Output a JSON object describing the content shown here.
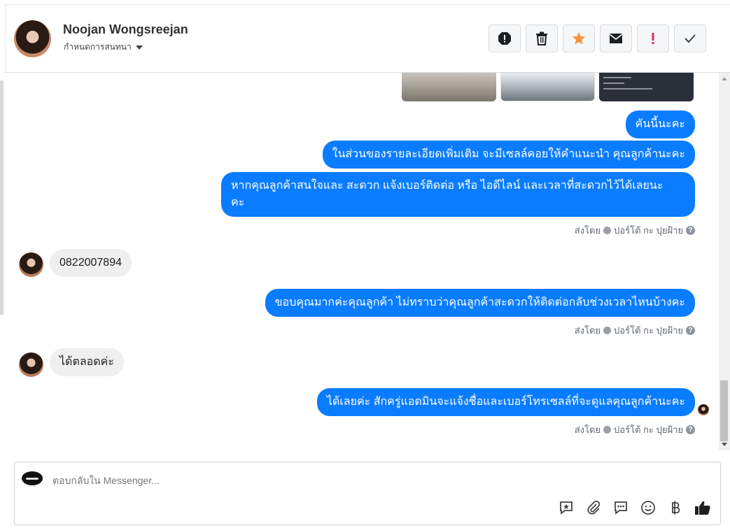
{
  "header": {
    "name": "Noojan Wongsreejan",
    "subtitle": "กำหนดการสนทนา"
  },
  "actions": [
    {
      "name": "spam-button",
      "icon": "stop-icon"
    },
    {
      "name": "delete-button",
      "icon": "trash-icon"
    },
    {
      "name": "star-button",
      "icon": "star-icon",
      "color": "#f7923a"
    },
    {
      "name": "mark-unread-button",
      "icon": "envelope-icon"
    },
    {
      "name": "follow-up-button",
      "icon": "exclamation-icon",
      "color": "#e0245e"
    },
    {
      "name": "done-button",
      "icon": "check-icon"
    }
  ],
  "messages": {
    "out1": "คันนี้นะคะ",
    "out2": "ในส่วนของรายละเอียดเพิ่มเติม จะมีเซลล์คอยให้คำแนะนำ คุณลูกค้านะคะ",
    "out3_line1": "หากคุณลูกค้าสนใจและ สะดวก แจ้งเบอร์ติดต่อ หรือ ไอดีไลน์ และเวลาที่สะดวกไว้ได้เลยนะ",
    "out3_line2": "คะ",
    "in1": "0822007894",
    "out4": "ขอบคุณมากค่ะคุณลูกค้า ไม่ทราบว่าคุณลูกค้าสะดวกให้ติดต่อกลับช่วงเวลาไหนบ้างคะ",
    "in2": "ได้ตลอดค่ะ",
    "out5": "ได้เลยค่ะ สักครู่แอดมินจะแจ้งชื่อและเบอร์โทรเซลล์ที่จะดูแลคุณลูกค้านะคะ"
  },
  "sent_by": {
    "prefix": "ส่งโดย",
    "agent": "ปอร์โต้ กะ ปุยฝ้าย",
    "help": "?"
  },
  "composer": {
    "placeholder": "ตอบกลับใน Messenger..."
  },
  "composer_tools": [
    "saved-reply-icon",
    "attach-icon",
    "quick-reply-icon",
    "emoji-icon",
    "baht-icon",
    "like-icon"
  ],
  "colors": {
    "outgoing_bubble": "#0a7cff",
    "incoming_bubble": "#efefef"
  }
}
